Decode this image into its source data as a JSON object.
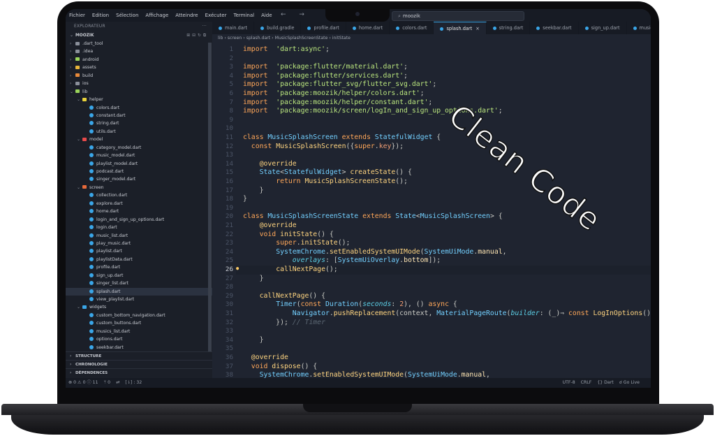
{
  "overlay_text": "Clean Code",
  "menu": [
    "Fichier",
    "Edition",
    "Sélection",
    "Affichage",
    "Atteindre",
    "Exécuter",
    "Terminal",
    "Aide"
  ],
  "nav_arrows": "← →",
  "search": {
    "value": "moozik",
    "icon": "search-icon"
  },
  "explorer": {
    "title": "EXPLORATEUR",
    "more": "···",
    "root": "MOOZIK",
    "sections": [
      "STRUCTURE",
      "CHRONOLOGIE",
      "DÉPENDENCES"
    ]
  },
  "tree": [
    {
      "depth": 0,
      "kind": "folder",
      "open": false,
      "label": ".dart_tool",
      "color": "#8a8f9a"
    },
    {
      "depth": 0,
      "kind": "folder",
      "open": false,
      "label": ".idea",
      "color": "#8a8f9a"
    },
    {
      "depth": 0,
      "kind": "folder",
      "open": false,
      "label": "android",
      "color": "#9bd55b"
    },
    {
      "depth": 0,
      "kind": "folder",
      "open": false,
      "label": "assets",
      "color": "#e8b53a"
    },
    {
      "depth": 0,
      "kind": "folder",
      "open": false,
      "label": "build",
      "color": "#e88a3a"
    },
    {
      "depth": 0,
      "kind": "folder",
      "open": false,
      "label": "ios",
      "color": "#8a8f9a"
    },
    {
      "depth": 0,
      "kind": "folder",
      "open": true,
      "label": "lib",
      "color": "#9bd55b"
    },
    {
      "depth": 1,
      "kind": "folder",
      "open": true,
      "label": "helper",
      "color": "#e8d23a"
    },
    {
      "depth": 2,
      "kind": "file",
      "label": "colors.dart"
    },
    {
      "depth": 2,
      "kind": "file",
      "label": "constant.dart"
    },
    {
      "depth": 2,
      "kind": "file",
      "label": "string.dart"
    },
    {
      "depth": 2,
      "kind": "file",
      "label": "utils.dart"
    },
    {
      "depth": 1,
      "kind": "folder",
      "open": true,
      "label": "model",
      "color": "#e84a4a"
    },
    {
      "depth": 2,
      "kind": "file",
      "label": "category_model.dart"
    },
    {
      "depth": 2,
      "kind": "file",
      "label": "music_model.dart"
    },
    {
      "depth": 2,
      "kind": "file",
      "label": "playlist_model.dart"
    },
    {
      "depth": 2,
      "kind": "file",
      "label": "podcast.dart"
    },
    {
      "depth": 2,
      "kind": "file",
      "label": "singer_model.dart"
    },
    {
      "depth": 1,
      "kind": "folder",
      "open": true,
      "label": "screen",
      "color": "#e86a3a"
    },
    {
      "depth": 2,
      "kind": "file",
      "label": "collection.dart"
    },
    {
      "depth": 2,
      "kind": "file",
      "label": "explore.dart"
    },
    {
      "depth": 2,
      "kind": "file",
      "label": "home.dart"
    },
    {
      "depth": 2,
      "kind": "file",
      "label": "login_and_sign_up_options.dart"
    },
    {
      "depth": 2,
      "kind": "file",
      "label": "login.dart"
    },
    {
      "depth": 2,
      "kind": "file",
      "label": "music_list.dart"
    },
    {
      "depth": 2,
      "kind": "file",
      "label": "play_music.dart"
    },
    {
      "depth": 2,
      "kind": "file",
      "label": "playlist.dart"
    },
    {
      "depth": 2,
      "kind": "file",
      "label": "playlistData.dart"
    },
    {
      "depth": 2,
      "kind": "file",
      "label": "profile.dart"
    },
    {
      "depth": 2,
      "kind": "file",
      "label": "sign_up.dart"
    },
    {
      "depth": 2,
      "kind": "file",
      "label": "singer_list.dart"
    },
    {
      "depth": 2,
      "kind": "file",
      "label": "splash.dart",
      "selected": true
    },
    {
      "depth": 2,
      "kind": "file",
      "label": "view_playlist.dart"
    },
    {
      "depth": 1,
      "kind": "folder",
      "open": true,
      "label": "widgets",
      "color": "#3aa6e8"
    },
    {
      "depth": 2,
      "kind": "file",
      "label": "custom_bottom_navigation.dart"
    },
    {
      "depth": 2,
      "kind": "file",
      "label": "custom_buttons.dart"
    },
    {
      "depth": 2,
      "kind": "file",
      "label": "musics_list.dart"
    },
    {
      "depth": 2,
      "kind": "file",
      "label": "options.dart"
    },
    {
      "depth": 2,
      "kind": "file",
      "label": "seekbar.dart"
    }
  ],
  "tabs": [
    {
      "label": "main.dart"
    },
    {
      "label": "build.gradle"
    },
    {
      "label": "profile.dart"
    },
    {
      "label": "home.dart"
    },
    {
      "label": "colors.dart"
    },
    {
      "label": "splash.dart",
      "active": true
    },
    {
      "label": "string.dart"
    },
    {
      "label": "seekbar.dart"
    },
    {
      "label": "sign_up.dart"
    },
    {
      "label": "musics_"
    }
  ],
  "breadcrumb": "lib › screen › splash.dart › MusicSplashScreenState › initState",
  "code": [
    {
      "n": 1,
      "tokens": [
        [
          "k",
          "import"
        ],
        [
          "",
          "  "
        ],
        [
          "s",
          "'dart:async'"
        ],
        [
          "",
          ";"
        ]
      ]
    },
    {
      "n": 2,
      "tokens": []
    },
    {
      "n": 3,
      "tokens": [
        [
          "k",
          "import"
        ],
        [
          "",
          "  "
        ],
        [
          "s",
          "'package:flutter/material.dart'"
        ],
        [
          "",
          ";"
        ]
      ]
    },
    {
      "n": 4,
      "tokens": [
        [
          "k",
          "import"
        ],
        [
          "",
          "  "
        ],
        [
          "s",
          "'package:flutter/services.dart'"
        ],
        [
          "",
          ";"
        ]
      ]
    },
    {
      "n": 5,
      "tokens": [
        [
          "k",
          "import"
        ],
        [
          "",
          "  "
        ],
        [
          "s",
          "'package:flutter_svg/flutter_svg.dart'"
        ],
        [
          "",
          ";"
        ]
      ]
    },
    {
      "n": 6,
      "tokens": [
        [
          "k",
          "import"
        ],
        [
          "",
          "  "
        ],
        [
          "s",
          "'package:moozik/helper/colors.dart'"
        ],
        [
          "",
          ";"
        ]
      ]
    },
    {
      "n": 7,
      "tokens": [
        [
          "k",
          "import"
        ],
        [
          "",
          "  "
        ],
        [
          "s",
          "'package:moozik/helper/constant.dart'"
        ],
        [
          "",
          ";"
        ]
      ]
    },
    {
      "n": 8,
      "tokens": [
        [
          "k",
          "import"
        ],
        [
          "",
          "  "
        ],
        [
          "s",
          "'package:moozik/screen/logIn_and_sign_up_options.dart'"
        ],
        [
          "",
          ";"
        ]
      ]
    },
    {
      "n": 9,
      "tokens": []
    },
    {
      "n": 10,
      "tokens": []
    },
    {
      "n": 11,
      "tokens": [
        [
          "k",
          "class"
        ],
        [
          "",
          " "
        ],
        [
          "t",
          "MusicSplashScreen"
        ],
        [
          "",
          " "
        ],
        [
          "k",
          "extends"
        ],
        [
          "",
          " "
        ],
        [
          "t",
          "StatefulWidget"
        ],
        [
          "",
          " {"
        ]
      ]
    },
    {
      "n": 12,
      "tokens": [
        [
          "",
          "  "
        ],
        [
          "k",
          "const"
        ],
        [
          "",
          " "
        ],
        [
          "f",
          "MusicSplashScreen"
        ],
        [
          "",
          "({"
        ],
        [
          "k",
          "super"
        ],
        [
          "",
          "."
        ],
        [
          "p",
          "key"
        ],
        [
          "",
          "});"
        ]
      ]
    },
    {
      "n": 13,
      "tokens": []
    },
    {
      "n": 14,
      "tokens": [
        [
          "",
          "    "
        ],
        [
          "c",
          "@override"
        ]
      ]
    },
    {
      "n": 15,
      "tokens": [
        [
          "",
          "    "
        ],
        [
          "t",
          "State"
        ],
        [
          "",
          "<"
        ],
        [
          "t",
          "StatefulWidget"
        ],
        [
          "",
          "> "
        ],
        [
          "f",
          "createState"
        ],
        [
          "",
          "() {"
        ]
      ]
    },
    {
      "n": 16,
      "tokens": [
        [
          "",
          "        "
        ],
        [
          "k",
          "return"
        ],
        [
          "",
          " "
        ],
        [
          "f",
          "MusicSplashScreenState"
        ],
        [
          "",
          "();"
        ]
      ]
    },
    {
      "n": 17,
      "tokens": [
        [
          "",
          "    }"
        ]
      ]
    },
    {
      "n": 18,
      "tokens": [
        [
          "",
          "}"
        ]
      ]
    },
    {
      "n": 19,
      "tokens": []
    },
    {
      "n": 20,
      "tokens": [
        [
          "k",
          "class"
        ],
        [
          "",
          " "
        ],
        [
          "t",
          "MusicSplashScreenState"
        ],
        [
          "",
          " "
        ],
        [
          "k",
          "extends"
        ],
        [
          "",
          " "
        ],
        [
          "t",
          "State"
        ],
        [
          "",
          "<"
        ],
        [
          "t",
          "MusicSplashScreen"
        ],
        [
          "",
          "> {"
        ]
      ]
    },
    {
      "n": 21,
      "tokens": [
        [
          "",
          "    "
        ],
        [
          "c",
          "@override"
        ]
      ]
    },
    {
      "n": 22,
      "tokens": [
        [
          "",
          "    "
        ],
        [
          "k",
          "void"
        ],
        [
          "",
          " "
        ],
        [
          "f",
          "initState"
        ],
        [
          "",
          "() {"
        ]
      ]
    },
    {
      "n": 23,
      "tokens": [
        [
          "",
          "        "
        ],
        [
          "k",
          "super"
        ],
        [
          "",
          "."
        ],
        [
          "f",
          "initState"
        ],
        [
          "",
          "();"
        ]
      ]
    },
    {
      "n": 24,
      "tokens": [
        [
          "",
          "        "
        ],
        [
          "t",
          "SystemChrome"
        ],
        [
          "",
          "."
        ],
        [
          "f",
          "setEnabledSystemUIMode"
        ],
        [
          "",
          "("
        ],
        [
          "t",
          "SystemUiMode"
        ],
        [
          "",
          "."
        ],
        [
          "d",
          "manual"
        ],
        [
          "",
          ","
        ]
      ]
    },
    {
      "n": 25,
      "tokens": [
        [
          "",
          "            "
        ],
        [
          "it",
          "overlays"
        ],
        [
          "",
          ": ["
        ],
        [
          "t",
          "SystemUiOverlay"
        ],
        [
          "",
          "."
        ],
        [
          "d",
          "bottom"
        ],
        [
          "",
          "]);"
        ]
      ]
    },
    {
      "n": 26,
      "tokens": [
        [
          "",
          "        "
        ],
        [
          "f",
          "callNextPage"
        ],
        [
          "",
          "();"
        ]
      ],
      "current": true
    },
    {
      "n": 27,
      "tokens": [
        [
          "",
          "    }"
        ]
      ]
    },
    {
      "n": 28,
      "tokens": []
    },
    {
      "n": 29,
      "tokens": [
        [
          "",
          "    "
        ],
        [
          "f",
          "callNextPage"
        ],
        [
          "",
          "() {"
        ]
      ]
    },
    {
      "n": 30,
      "tokens": [
        [
          "",
          "        "
        ],
        [
          "t",
          "Timer"
        ],
        [
          "",
          "("
        ],
        [
          "k",
          "const"
        ],
        [
          "",
          " "
        ],
        [
          "t",
          "Duration"
        ],
        [
          "",
          "("
        ],
        [
          "it",
          "seconds"
        ],
        [
          "",
          ": "
        ],
        [
          "p",
          "2"
        ],
        [
          "",
          "), () "
        ],
        [
          "k",
          "async"
        ],
        [
          "",
          " {"
        ]
      ]
    },
    {
      "n": 31,
      "tokens": [
        [
          "",
          "            "
        ],
        [
          "t",
          "Navigator"
        ],
        [
          "",
          "."
        ],
        [
          "f",
          "pushReplacement"
        ],
        [
          "",
          "(context, "
        ],
        [
          "t",
          "MaterialPageRoute"
        ],
        [
          "",
          "("
        ],
        [
          "it",
          "builder"
        ],
        [
          "",
          ": (_)⇒ "
        ],
        [
          "k",
          "const"
        ],
        [
          "",
          " "
        ],
        [
          "f",
          "LogInOptions"
        ],
        [
          "",
          "()"
        ]
      ]
    },
    {
      "n": 32,
      "tokens": [
        [
          "",
          "        }); "
        ],
        [
          "cm",
          "// Timer"
        ]
      ]
    },
    {
      "n": 33,
      "tokens": []
    },
    {
      "n": 34,
      "tokens": [
        [
          "",
          "    }"
        ]
      ]
    },
    {
      "n": 35,
      "tokens": []
    },
    {
      "n": 36,
      "tokens": [
        [
          "",
          "  "
        ],
        [
          "c",
          "@override"
        ]
      ]
    },
    {
      "n": 37,
      "tokens": [
        [
          "",
          "  "
        ],
        [
          "k",
          "void"
        ],
        [
          "",
          " "
        ],
        [
          "f",
          "dispose"
        ],
        [
          "",
          "() {"
        ]
      ]
    },
    {
      "n": 38,
      "tokens": [
        [
          "",
          "    "
        ],
        [
          "t",
          "SystemChrome"
        ],
        [
          "",
          "."
        ],
        [
          "f",
          "setEnabledSystemUIMode"
        ],
        [
          "",
          "("
        ],
        [
          "t",
          "SystemUiMode"
        ],
        [
          "",
          "."
        ],
        [
          "d",
          "manual"
        ],
        [
          "",
          ","
        ]
      ]
    }
  ],
  "status": {
    "left": [
      "⊗ 0 ⚠ 0 ⓘ 11",
      "ᛘ 0",
      "⇄",
      "[⇂] : 32"
    ],
    "right": [
      "UTF-8",
      "CRLF",
      "{} Dart",
      "☌ Go Live"
    ]
  }
}
